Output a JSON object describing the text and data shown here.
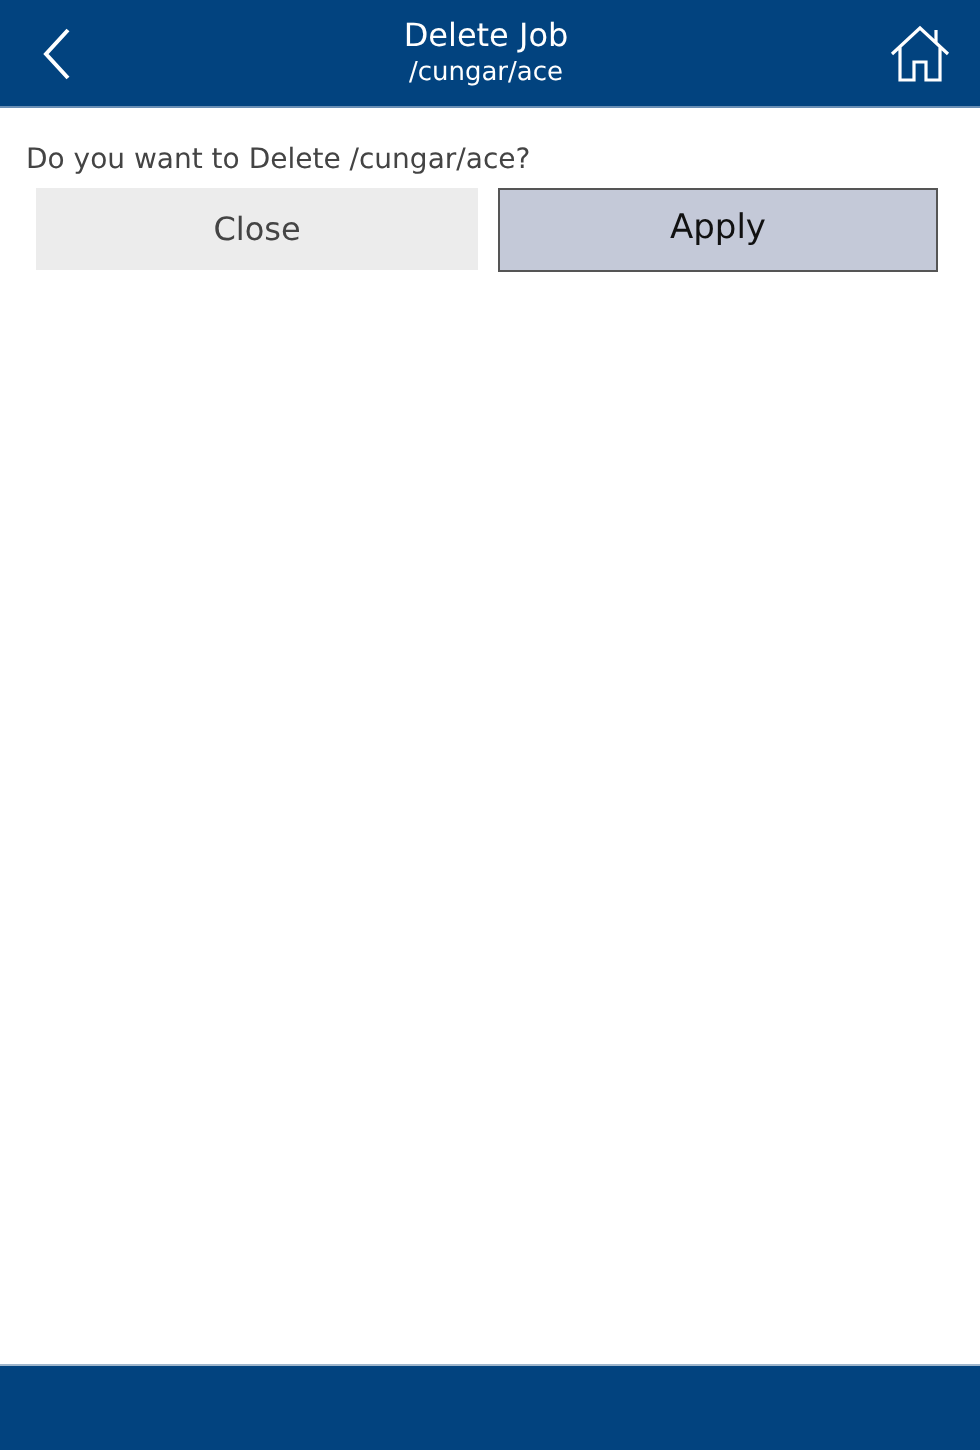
{
  "header": {
    "title": "Delete Job",
    "subtitle": "/cungar/ace"
  },
  "prompt": "Do you want to Delete /cungar/ace?",
  "buttons": [
    {
      "label": "Close",
      "selected": false
    },
    {
      "label": "Apply",
      "selected": true
    }
  ]
}
